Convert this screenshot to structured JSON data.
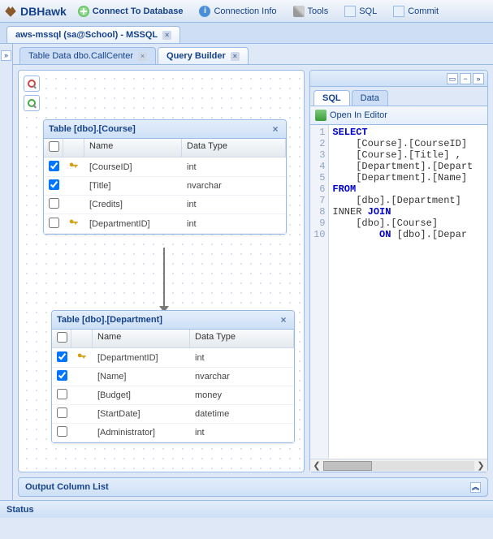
{
  "app": {
    "name": "DBHawk"
  },
  "toolbar": {
    "connect": "Connect To Database",
    "connInfo": "Connection Info",
    "tools": "Tools",
    "sql": "SQL",
    "commit": "Commit"
  },
  "connTab": {
    "label": "aws-mssql (sa@School) - MSSQL"
  },
  "subTabs": {
    "tableData": "Table Data dbo.CallCenter",
    "queryBuilder": "Query Builder"
  },
  "tables": [
    {
      "title": "Table [dbo].[Course]",
      "headers": {
        "name": "Name",
        "type": "Data Type"
      },
      "rows": [
        {
          "checked": true,
          "icon": "pk",
          "name": "[CourseID]",
          "type": "int"
        },
        {
          "checked": true,
          "icon": "",
          "name": "[Title]",
          "type": "nvarchar"
        },
        {
          "checked": false,
          "icon": "",
          "name": "[Credits]",
          "type": "int"
        },
        {
          "checked": false,
          "icon": "fk",
          "name": "[DepartmentID]",
          "type": "int"
        }
      ]
    },
    {
      "title": "Table [dbo].[Department]",
      "headers": {
        "name": "Name",
        "type": "Data Type"
      },
      "rows": [
        {
          "checked": true,
          "icon": "pk",
          "name": "[DepartmentID]",
          "type": "int"
        },
        {
          "checked": true,
          "icon": "",
          "name": "[Name]",
          "type": "nvarchar"
        },
        {
          "checked": false,
          "icon": "",
          "name": "[Budget]",
          "type": "money"
        },
        {
          "checked": false,
          "icon": "",
          "name": "[StartDate]",
          "type": "datetime"
        },
        {
          "checked": false,
          "icon": "",
          "name": "[Administrator]",
          "type": "int"
        }
      ]
    }
  ],
  "rightPanel": {
    "tabs": {
      "sql": "SQL",
      "data": "Data"
    },
    "openEditor": "Open In Editor",
    "sql": {
      "lines": [
        "1",
        "2",
        "3",
        "4",
        "5",
        "6",
        "7",
        "8",
        "9",
        "10"
      ],
      "l1": "SELECT",
      "l2": "    [Course].[CourseID]",
      "l3": "    [Course].[Title] ,",
      "l4": "    [Department].[Depart",
      "l5": "    [Department].[Name]",
      "l6": "FROM",
      "l7": "    [dbo].[Department]",
      "l8a": "INNER ",
      "l8b": "JOIN",
      "l9": "    [dbo].[Course]",
      "l10a": "        ",
      "l10b": "ON",
      "l10c": " [dbo].[Depar"
    }
  },
  "output": {
    "title": "Output Column List"
  },
  "status": {
    "label": "Status"
  }
}
